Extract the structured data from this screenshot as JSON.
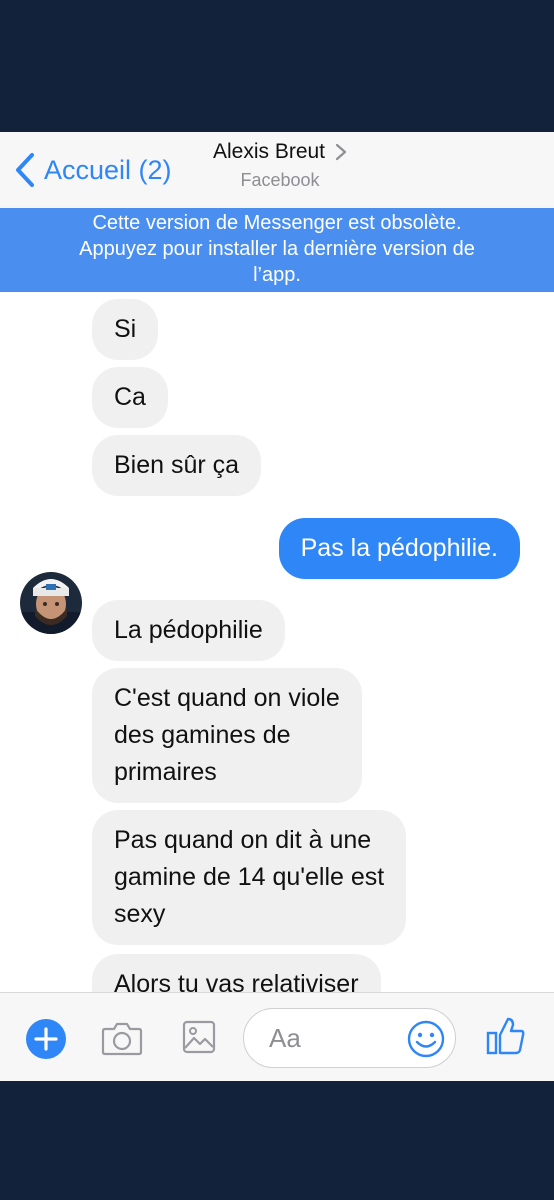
{
  "header": {
    "back_label": "Accueil (2)",
    "contact_name": "Alexis Breut",
    "contact_source": "Facebook"
  },
  "banner": {
    "line1": "Cette version de Messenger est obsolète.",
    "line2": "Appuyez pour installer la dernière version de",
    "line3": "l’app."
  },
  "messages": [
    {
      "direction": "in",
      "lines": [
        "Si"
      ]
    },
    {
      "direction": "in",
      "lines": [
        "Ca"
      ]
    },
    {
      "direction": "in",
      "lines": [
        "Bien sûr ça"
      ]
    },
    {
      "direction": "out",
      "lines": [
        "Pas la pédophilie."
      ]
    },
    {
      "direction": "in",
      "lines": [
        "La pédophilie"
      ]
    },
    {
      "direction": "in",
      "lines": [
        "C'est quand on viole",
        "des gamines de",
        "primaires"
      ]
    },
    {
      "direction": "in",
      "lines": [
        "Pas quand on dit à une",
        "gamine de 14 qu'elle est",
        "sexy"
      ]
    },
    {
      "direction": "in",
      "lines": [
        "Alors tu vas relativiser"
      ]
    }
  ],
  "composer": {
    "placeholder": "Aa",
    "icons": [
      "plus-icon",
      "camera-icon",
      "image-icon",
      "emoji-icon",
      "thumbs-up-icon"
    ]
  },
  "colors": {
    "accent": "#2f86f6",
    "banner": "#4a8ff0",
    "incoming_bubble": "#f0f0f0",
    "frame": "#13223b"
  }
}
